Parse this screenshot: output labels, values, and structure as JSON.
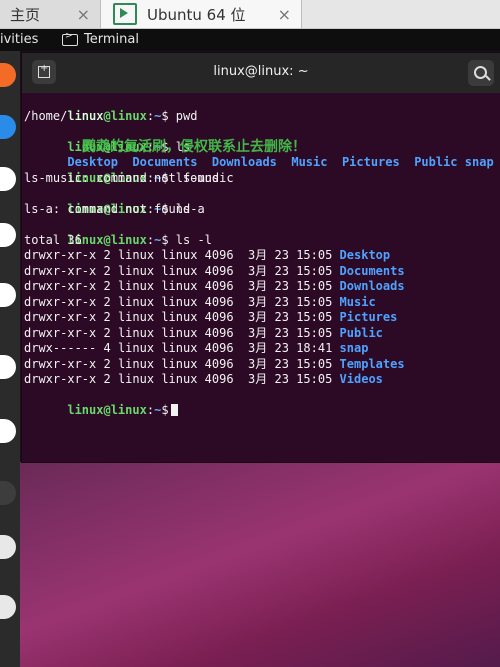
{
  "vm_tabs": [
    {
      "label": "主页",
      "close": "×"
    },
    {
      "label": "Ubuntu 64 位",
      "close": "×"
    }
  ],
  "gnome_bar": {
    "activities": "ivities",
    "app_label": "Terminal"
  },
  "terminal": {
    "title": "linux@linux: ~",
    "prompt": {
      "user_host": "linux@linux",
      "sep": ":",
      "dir": "~",
      "dollar": "$"
    },
    "commands": [
      {
        "cmd": "pwd",
        "output": [
          "/home/linux"
        ]
      },
      {
        "cmd": "ls",
        "ls_items": [
          "Desktop",
          "Documents",
          "Downloads",
          "Music",
          "Pictures",
          "Public",
          "snap"
        ]
      },
      {
        "cmd": "ls-music",
        "output": [
          "ls-music: command not found"
        ]
      },
      {
        "cmd": "ls-a",
        "output": [
          "ls-a: command not found"
        ]
      },
      {
        "cmd": "ls -l",
        "output": [
          "total 36"
        ]
      }
    ],
    "overlay_text": "鹦鹉的复活刷，侵权联系止去删除！",
    "ls_long_rows": [
      {
        "perm": "drwxr-xr-x",
        "links": "2",
        "user": "linux",
        "group": "linux",
        "size": "4096",
        "month": "3月",
        "day": "23",
        "time": "15:05",
        "name": "Desktop"
      },
      {
        "perm": "drwxr-xr-x",
        "links": "2",
        "user": "linux",
        "group": "linux",
        "size": "4096",
        "month": "3月",
        "day": "23",
        "time": "15:05",
        "name": "Documents"
      },
      {
        "perm": "drwxr-xr-x",
        "links": "2",
        "user": "linux",
        "group": "linux",
        "size": "4096",
        "month": "3月",
        "day": "23",
        "time": "15:05",
        "name": "Downloads"
      },
      {
        "perm": "drwxr-xr-x",
        "links": "2",
        "user": "linux",
        "group": "linux",
        "size": "4096",
        "month": "3月",
        "day": "23",
        "time": "15:05",
        "name": "Music"
      },
      {
        "perm": "drwxr-xr-x",
        "links": "2",
        "user": "linux",
        "group": "linux",
        "size": "4096",
        "month": "3月",
        "day": "23",
        "time": "15:05",
        "name": "Pictures"
      },
      {
        "perm": "drwxr-xr-x",
        "links": "2",
        "user": "linux",
        "group": "linux",
        "size": "4096",
        "month": "3月",
        "day": "23",
        "time": "15:05",
        "name": "Public"
      },
      {
        "perm": "drwx------",
        "links": "4",
        "user": "linux",
        "group": "linux",
        "size": "4096",
        "month": "3月",
        "day": "23",
        "time": "18:41",
        "name": "snap"
      },
      {
        "perm": "drwxr-xr-x",
        "links": "2",
        "user": "linux",
        "group": "linux",
        "size": "4096",
        "month": "3月",
        "day": "23",
        "time": "15:05",
        "name": "Templates"
      },
      {
        "perm": "drwxr-xr-x",
        "links": "2",
        "user": "linux",
        "group": "linux",
        "size": "4096",
        "month": "3月",
        "day": "23",
        "time": "15:05",
        "name": "Videos"
      }
    ]
  },
  "icons": {
    "new_tab": "new-tab-icon",
    "search": "search-icon",
    "vm": "vm-play-icon",
    "terminal": "terminal-icon"
  },
  "colors": {
    "prompt_green": "#67d96a",
    "dir_blue": "#4fa2ff",
    "terminal_bg": "#2c0a25"
  }
}
